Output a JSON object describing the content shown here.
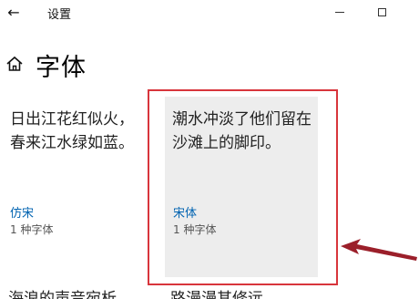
{
  "window": {
    "title": "设置",
    "back_icon": "←",
    "minimize_icon": "minimize-icon",
    "maximize_icon": "maximize-icon"
  },
  "header": {
    "title": "字体",
    "home_icon": "home-icon"
  },
  "font_cards": [
    {
      "sample": "日出江花红似火，春来江水绿如蓝。",
      "name": "仿宋",
      "count": "1 种字体"
    },
    {
      "sample": "潮水冲淡了他们留在沙滩上的脚印。",
      "name": "宋体",
      "count": "1 种字体"
    }
  ],
  "bottom_partial": {
    "left": "海浪的声音宛析",
    "right": "路漫漫其修远"
  },
  "colors": {
    "accent": "#0063b1",
    "highlight": "#d8353c",
    "arrow": "#9b1f2a",
    "selected_card_bg": "#ededed"
  }
}
